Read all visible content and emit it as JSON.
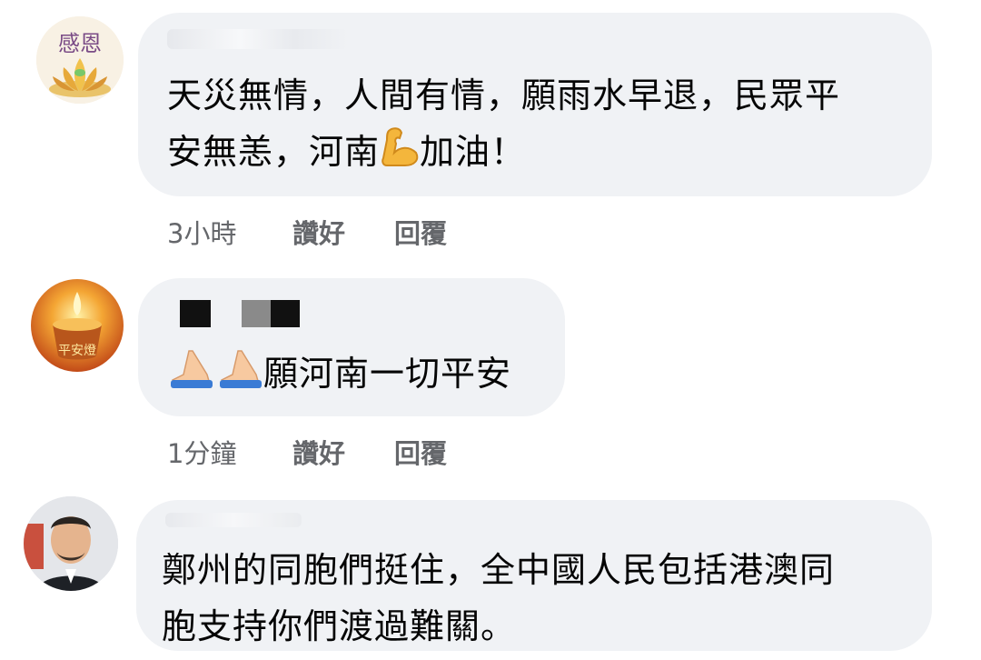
{
  "comments": [
    {
      "text_line1": "天災無情，人間有情，願雨水早退，民眾平",
      "text_line2_a": "安無恙，河南",
      "text_line2_b": "加油！",
      "text_emoji": "flexed-biceps-emoji",
      "avatar_label": "感恩",
      "timestamp": "3小時",
      "like_label": "讚好",
      "reply_label": "回覆"
    },
    {
      "text_main": "願河南一切平安",
      "text_emoji": "folded-hands-emoji",
      "avatar_label": "平安燈",
      "timestamp": "1分鐘",
      "like_label": "讚好",
      "reply_label": "回覆"
    },
    {
      "text_line1": "鄭州的同胞們挺住，全中國人民包括港澳同",
      "text_line2": "胞支持你們渡過難關。"
    }
  ],
  "colors": {
    "bubble": "#f0f2f5",
    "meta_text": "#65676b",
    "comment_text": "#050505"
  }
}
